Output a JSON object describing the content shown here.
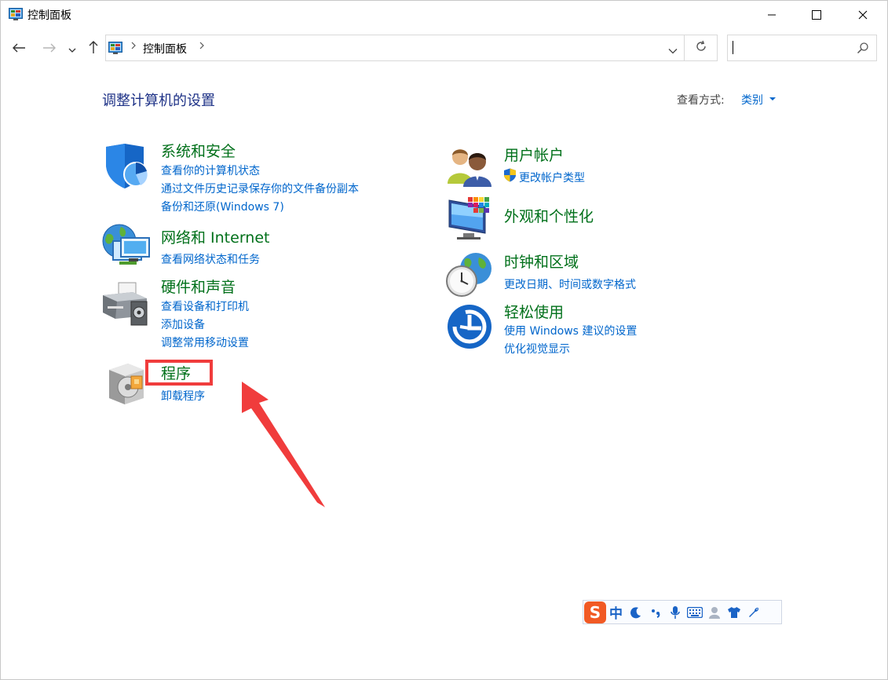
{
  "window": {
    "title": "控制面板",
    "icon": "control-panel-icon"
  },
  "window_controls": [
    "minimize-icon",
    "maximize-icon",
    "close-icon"
  ],
  "navigation": {
    "back": "back-arrow-icon",
    "forward": "forward-arrow-icon",
    "recent": "chevron-down-icon",
    "up": "up-arrow-icon"
  },
  "address_bar": {
    "path": [
      "控制面板"
    ],
    "refresh": "refresh-icon"
  },
  "search": {
    "value": "",
    "placeholder": "",
    "icon": "search-icon"
  },
  "main": {
    "heading": "调整计算机的设置",
    "view_by": {
      "label": "查看方式:",
      "value": "类别"
    },
    "categories_left": [
      {
        "title": "系统和安全",
        "icon": "system-security-shield-icon",
        "links": [
          "查看你的计算机状态",
          "通过文件历史记录保存你的文件备份副本",
          "备份和还原(Windows 7)"
        ]
      },
      {
        "title": "网络和 Internet",
        "icon": "network-globe-icon",
        "links": [
          "查看网络状态和任务"
        ]
      },
      {
        "title": "硬件和声音",
        "icon": "printer-speaker-icon",
        "links": [
          "查看设备和打印机",
          "添加设备",
          "调整常用移动设置"
        ]
      },
      {
        "title": "程序",
        "icon": "programs-disc-icon",
        "links": [
          "卸载程序"
        ]
      }
    ],
    "categories_right": [
      {
        "title": "用户帐户",
        "icon": "user-accounts-icon",
        "links": [
          "更改帐户类型"
        ],
        "link_icon": "uac-shield-icon"
      },
      {
        "title": "外观和个性化",
        "icon": "appearance-monitor-icon",
        "links": []
      },
      {
        "title": "时钟和区域",
        "icon": "clock-globe-icon",
        "links": [
          "更改日期、时间或数字格式"
        ]
      },
      {
        "title": "轻松使用",
        "icon": "ease-of-access-icon",
        "links": [
          "使用 Windows 建议的设置",
          "优化视觉显示"
        ]
      }
    ]
  },
  "annotation": {
    "highlight_color": "#f03c3c",
    "highlight_target": "程序"
  },
  "ime_toolbar": {
    "logo": "S",
    "mode": "中",
    "items": [
      "moon-icon",
      "punctuation-icon",
      "microphone-icon",
      "keyboard-icon",
      "user-icon",
      "shirt-icon",
      "wrench-icon"
    ]
  },
  "colors": {
    "heading": "#1e3287",
    "category_title": "#00701a",
    "link": "#0066cc"
  }
}
